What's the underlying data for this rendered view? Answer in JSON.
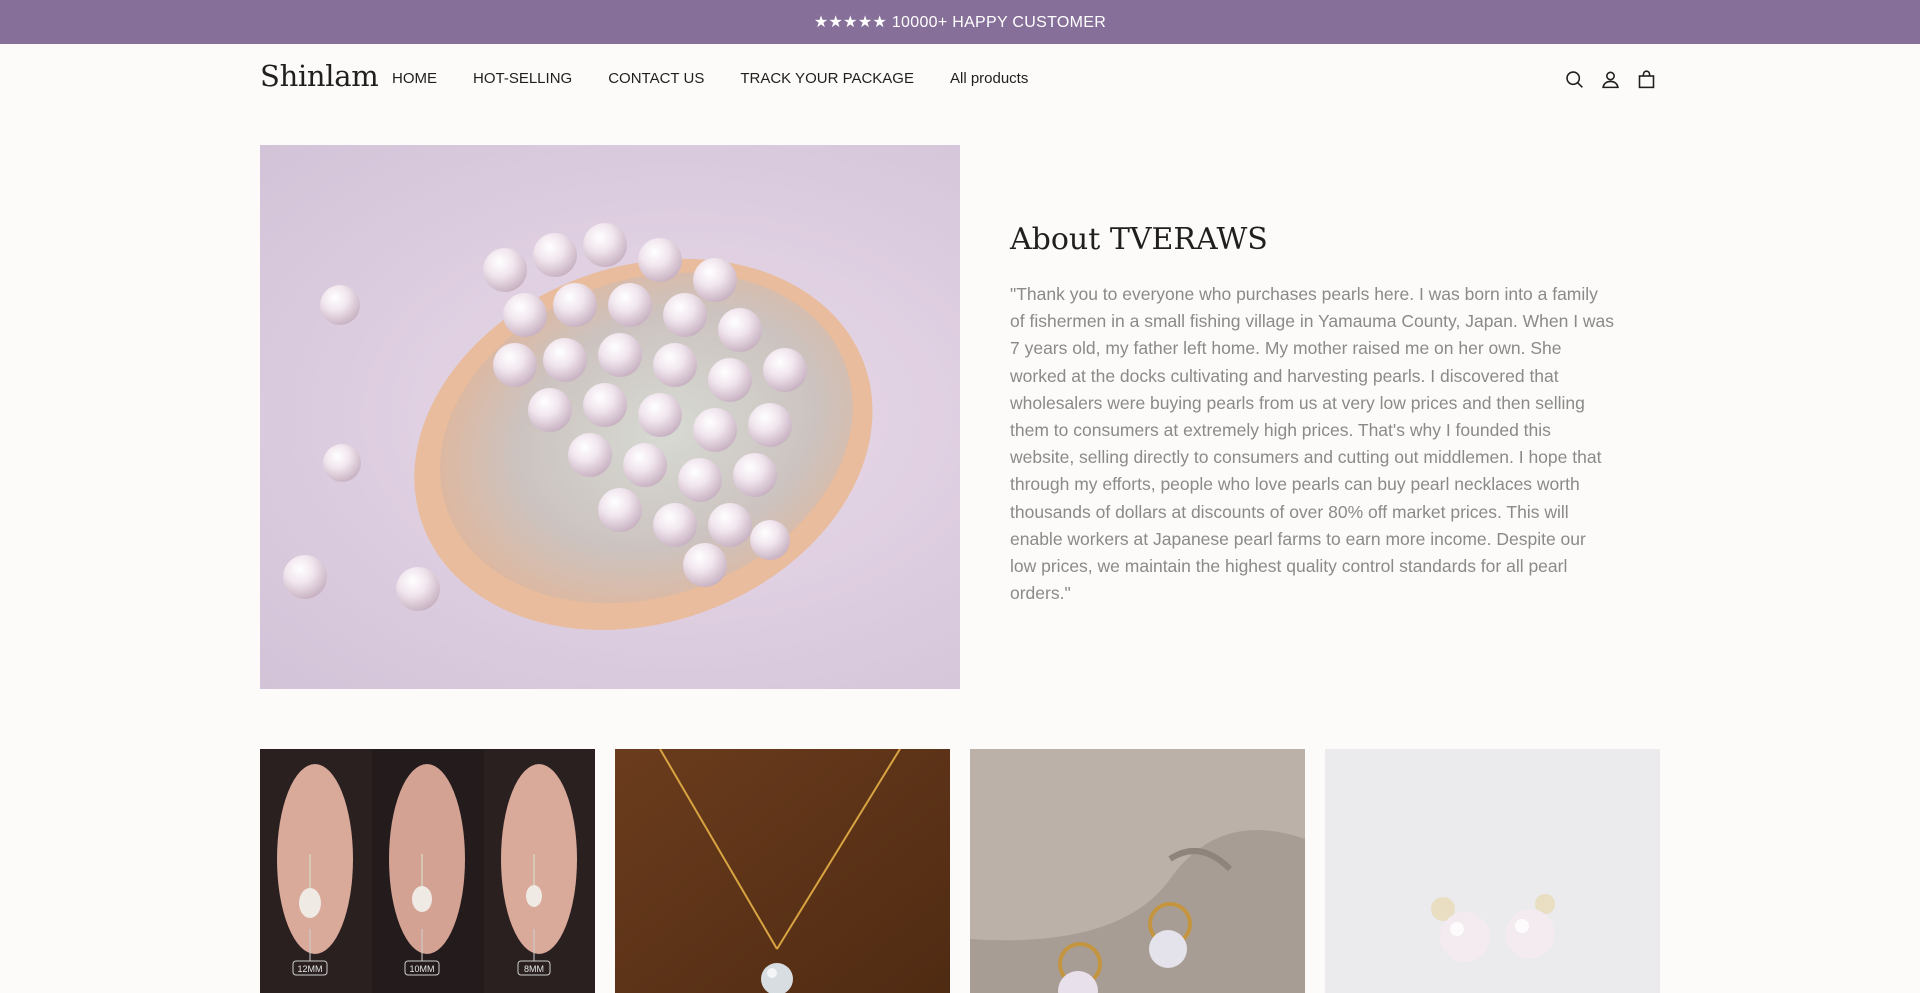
{
  "announcement": {
    "text": "★★★★★ 10000+ HAPPY CUSTOMER"
  },
  "header": {
    "logo": "Shinlam",
    "nav": [
      "HOME",
      "HOT-SELLING",
      "CONTACT US",
      "TRACK YOUR PACKAGE",
      "All products"
    ],
    "icons": [
      "search-icon",
      "account-icon",
      "cart-icon"
    ]
  },
  "about": {
    "title": "About TVERAWS",
    "body": "\"Thank you to everyone who purchases pearls here. I was born into a family of fishermen in a small fishing village in Yamauma County, Japan. When I was 7 years old, my father left home. My mother raised me on her own. She worked at the docks cultivating and harvesting pearls. I discovered that wholesalers were buying pearls from us at very low prices and then selling them to consumers at extremely high prices. That's why I founded this website, selling directly to consumers and cutting out middlemen. I hope that through my efforts, people who love pearls can buy pearl necklaces worth thousands of dollars at discounts of over 80% off market prices. This will enable workers at Japanese pearl farms to earn more income. Despite our low prices, we maintain the highest quality control standards for all pearl orders.\""
  },
  "products": {
    "size_labels": [
      "12MM",
      "10MM",
      "8MM"
    ]
  },
  "colors": {
    "announcement_bg": "#866f98",
    "page_bg": "#fcfbf9",
    "body_text": "#8a8a8a"
  }
}
